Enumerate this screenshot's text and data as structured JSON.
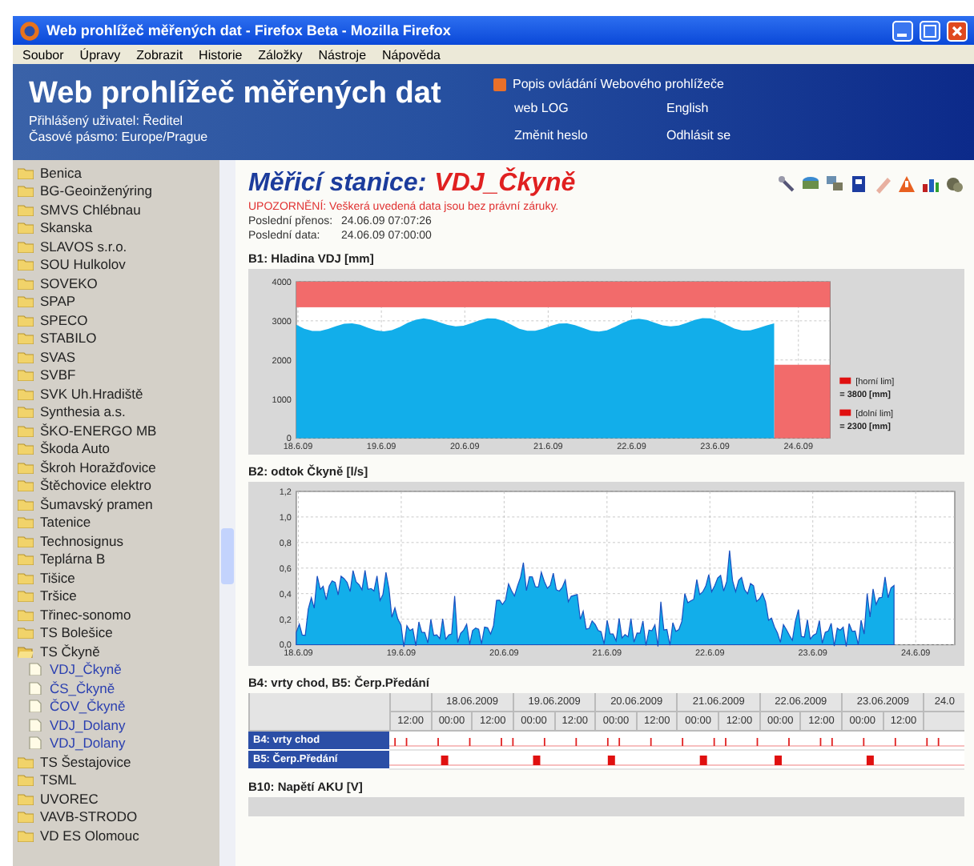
{
  "window": {
    "title": "Web prohlížeč měřených dat - Firefox Beta - Mozilla Firefox"
  },
  "menu": [
    "Soubor",
    "Úpravy",
    "Zobrazit",
    "Historie",
    "Záložky",
    "Nástroje",
    "Nápověda"
  ],
  "header": {
    "title": "Web prohlížeč měřených dat",
    "user": "Přihlášený uživatel: Ředitel",
    "timezone": "Časové pásmo: Europe/Prague",
    "help_link": "Popis ovládání Webového prohlížeče",
    "links": [
      "web LOG",
      "English",
      "Změnit heslo",
      "Odhlásit se"
    ]
  },
  "sidebar": {
    "items": [
      {
        "label": "Benica",
        "expanded": false
      },
      {
        "label": "BG-Geoinženýring",
        "expanded": false
      },
      {
        "label": "SMVS Chlébnau",
        "expanded": false
      },
      {
        "label": "Skanska",
        "expanded": false
      },
      {
        "label": "SLAVOS s.r.o.",
        "expanded": false
      },
      {
        "label": "SOU Hulkolov",
        "expanded": false
      },
      {
        "label": "SOVEKO",
        "expanded": false
      },
      {
        "label": "SPAP",
        "expanded": false
      },
      {
        "label": "SPECO",
        "expanded": false
      },
      {
        "label": "STABILO",
        "expanded": false
      },
      {
        "label": "SVAS",
        "expanded": false
      },
      {
        "label": "SVBF",
        "expanded": false
      },
      {
        "label": "SVK Uh.Hradiště",
        "expanded": false
      },
      {
        "label": "Synthesia a.s.",
        "expanded": false
      },
      {
        "label": "ŠKO-ENERGO MB",
        "expanded": false
      },
      {
        "label": "Škoda Auto",
        "expanded": false
      },
      {
        "label": "Škroh Horažďovice",
        "expanded": false
      },
      {
        "label": "Štěchovice elektro",
        "expanded": false
      },
      {
        "label": "Šumavský pramen",
        "expanded": false
      },
      {
        "label": "Tatenice",
        "expanded": false
      },
      {
        "label": "Technosignus",
        "expanded": false
      },
      {
        "label": "Teplárna B",
        "expanded": false
      },
      {
        "label": "Tišice",
        "expanded": false
      },
      {
        "label": "Tršice",
        "expanded": false
      },
      {
        "label": "Třinec-sonomo",
        "expanded": false
      },
      {
        "label": "TS Bolešice",
        "expanded": false
      },
      {
        "label": "TS Čkyně",
        "expanded": true,
        "children": [
          {
            "label": "VDJ_Čkyně"
          },
          {
            "label": "ČS_Čkyně"
          },
          {
            "label": "ČOV_Čkyně"
          },
          {
            "label": "VDJ_Dolany"
          },
          {
            "label": "VDJ_Dolany"
          }
        ]
      },
      {
        "label": "TS Šestajovice",
        "expanded": false
      },
      {
        "label": "TSML",
        "expanded": false
      },
      {
        "label": "UVOREC",
        "expanded": false
      },
      {
        "label": "VAVB-STRODO",
        "expanded": false
      },
      {
        "label": "VD ES Olomouc",
        "expanded": false
      }
    ]
  },
  "main": {
    "station_label": "Měřicí stanice:",
    "station_name": "VDJ_Čkyně",
    "warning": "UPOZORNĚNÍ: Veškerá uvedená data jsou bez právní záruky.",
    "info": [
      {
        "label": "Poslední přenos:",
        "value": "24.06.09 07:07:26"
      },
      {
        "label": "Poslední data:",
        "value": "24.06.09 07:00:00"
      }
    ],
    "sections": [
      {
        "kind": "level_chart",
        "title": "B1: Hladina VDJ [mm]",
        "y_ticks": [
          "4000",
          "3000",
          "2000",
          "1000",
          "0"
        ],
        "x_ticks": [
          "18.6.09",
          "19.6.09",
          "20.6.09",
          "21.6.09",
          "22.6.09",
          "23.6.09",
          "24.6.09"
        ],
        "legend": [
          {
            "label": "[horní lim]",
            "value": "= 3800 [mm]"
          },
          {
            "label": "[dolní lim]",
            "value": "= 2300 [mm]"
          }
        ]
      },
      {
        "kind": "flow_chart",
        "title": "B2: odtok Čkyně [l/s]",
        "y_ticks": [
          "1,2",
          "1,0",
          "0,8",
          "0,6",
          "0,4",
          "0,2",
          "0,0"
        ],
        "x_ticks": [
          "18.6.09",
          "19.6.09",
          "20.6.09",
          "21.6.09",
          "22.6.09",
          "23.6.09",
          "24.6.09"
        ]
      },
      {
        "kind": "event_table",
        "title": "B4: vrty chod, B5: Čerp.Předání",
        "dates": [
          "18.06.2009",
          "19.06.2009",
          "20.06.2009",
          "21.06.2009",
          "22.06.2009",
          "23.06.2009",
          "24.0"
        ],
        "times": [
          "12:00",
          "00:00",
          "12:00",
          "00:00",
          "12:00",
          "00:00",
          "12:00",
          "00:00",
          "12:00",
          "00:00",
          "12:00",
          "00:00",
          "12:00"
        ],
        "rows": [
          {
            "label": "B4: vrty chod",
            "kind": "pulses"
          },
          {
            "label": "B5: Čerp.Předání",
            "kind": "blocks"
          }
        ]
      },
      {
        "kind": "collapsed",
        "title": "B10: Napětí AKU [V]"
      }
    ]
  }
}
